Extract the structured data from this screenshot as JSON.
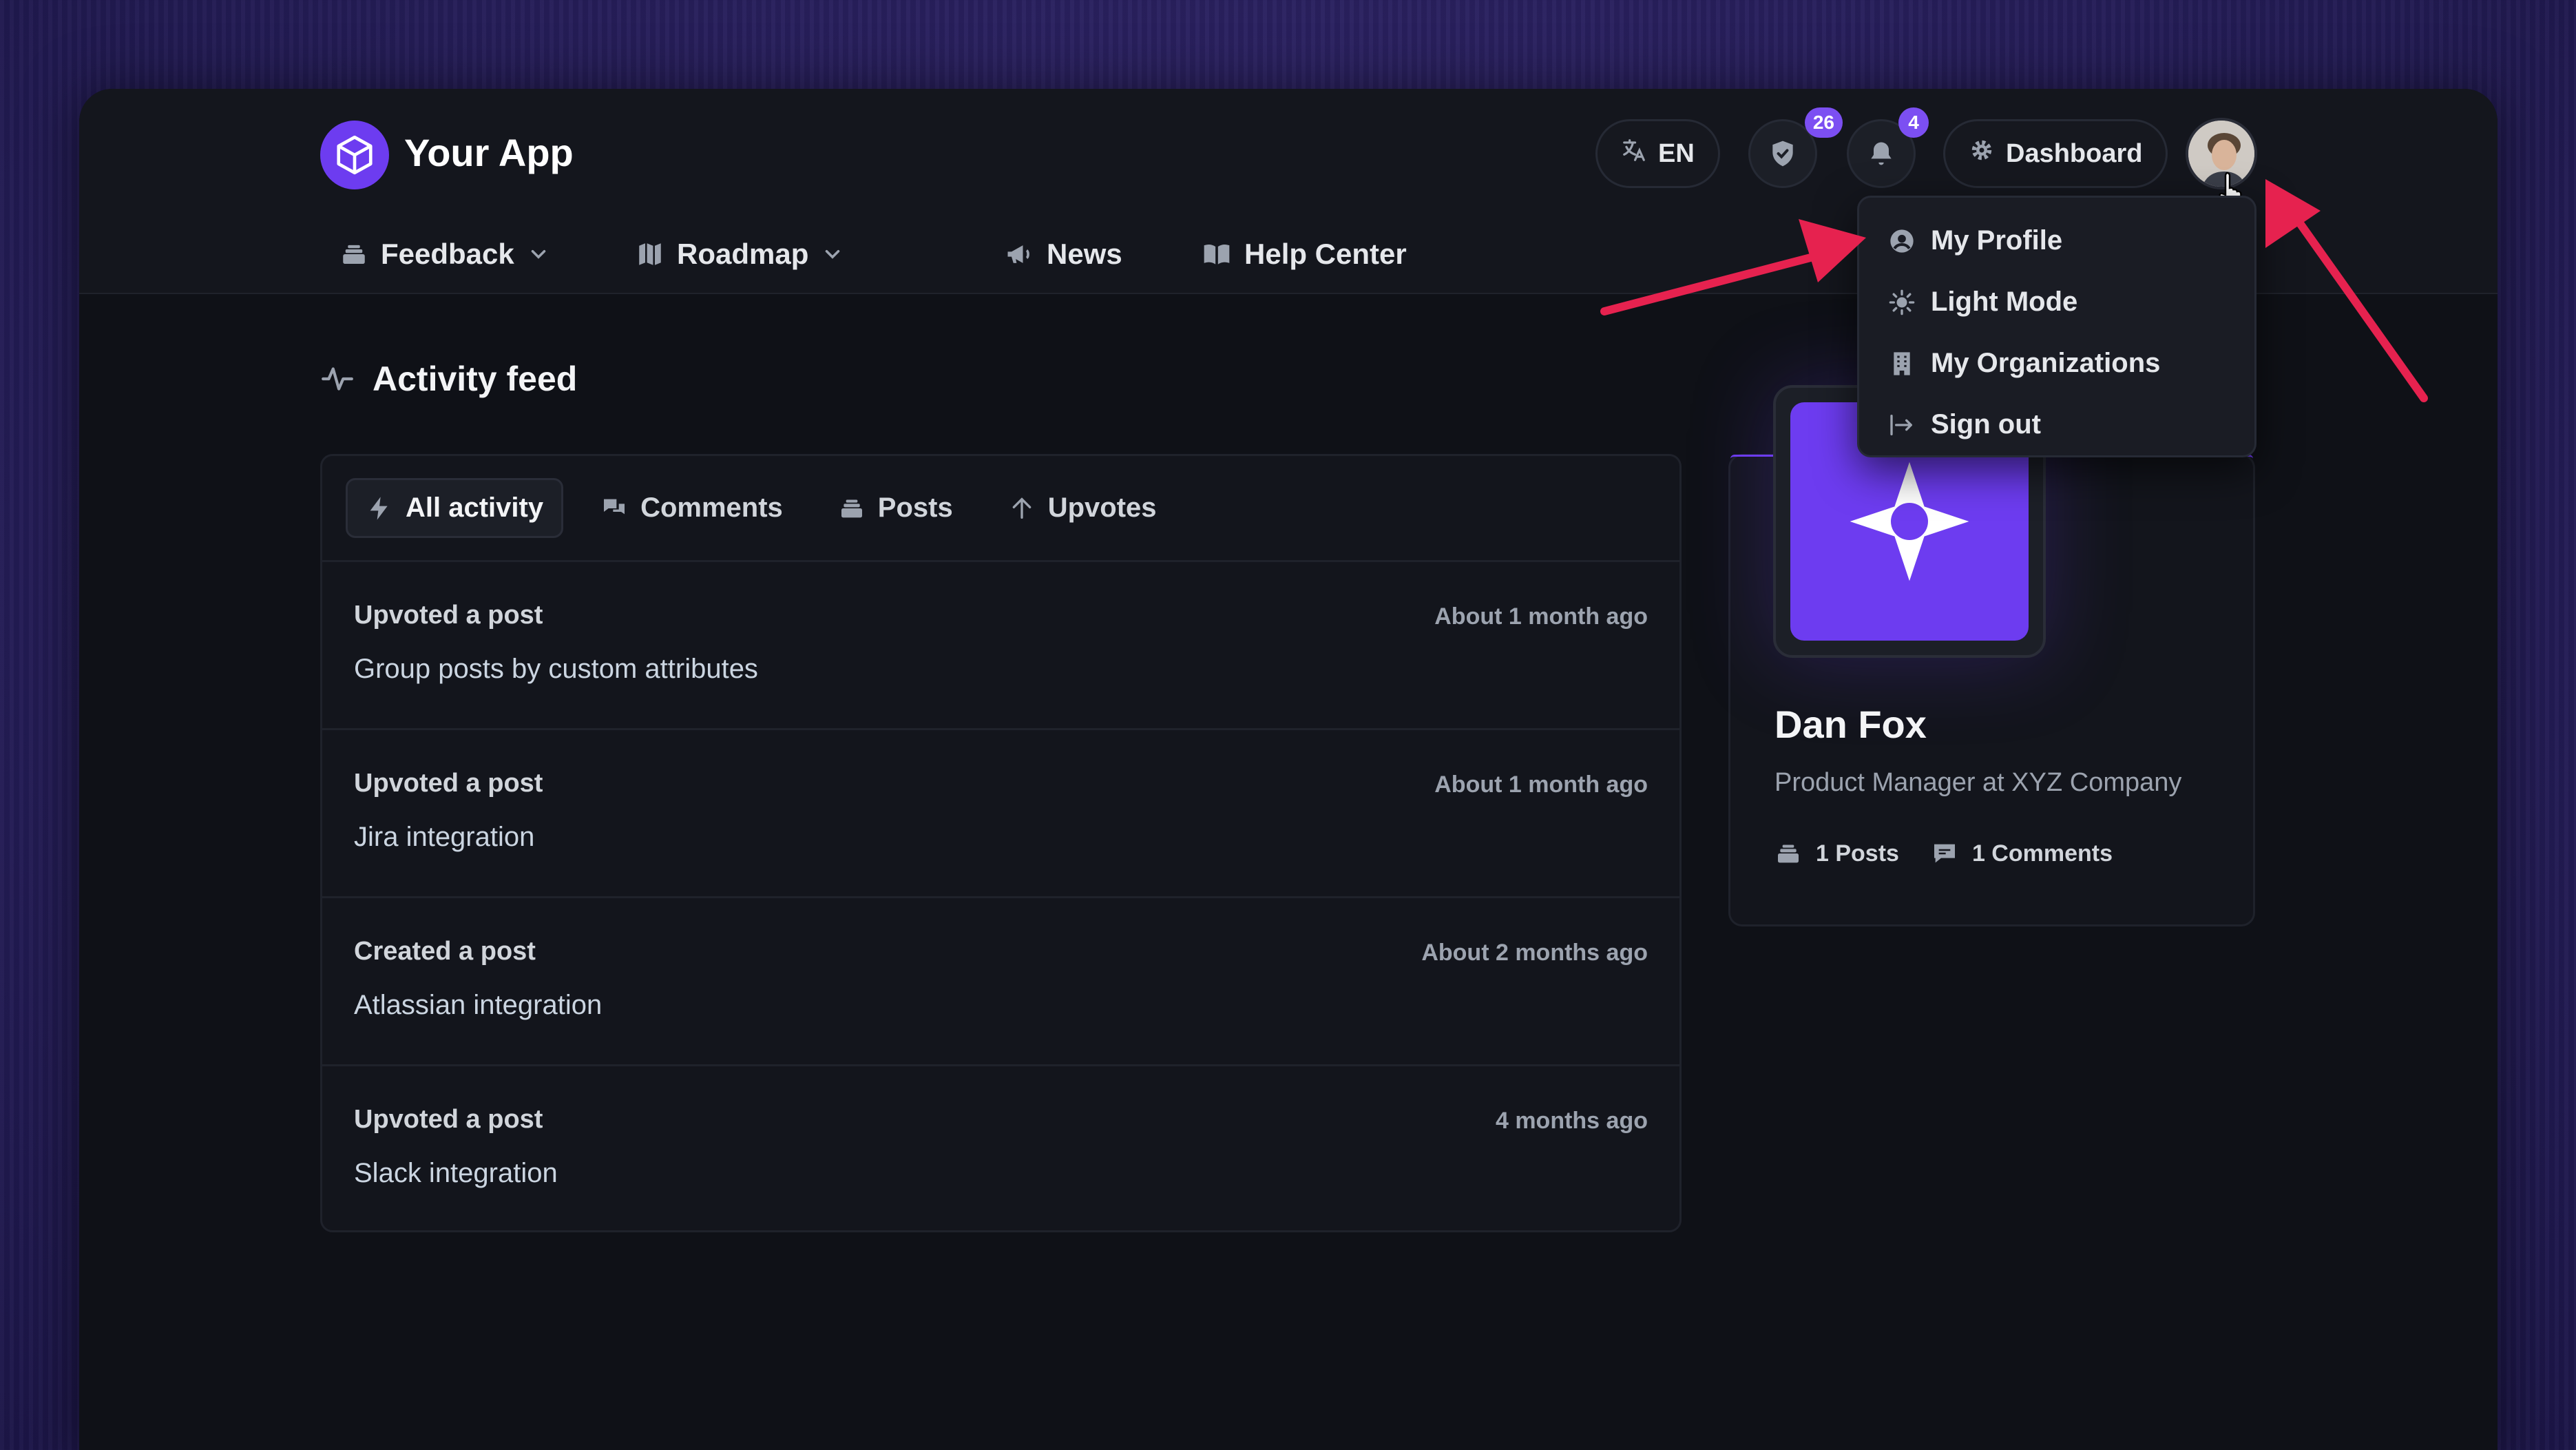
{
  "app": {
    "name": "Your App"
  },
  "header": {
    "language": "EN",
    "shield_badge": "26",
    "bell_badge": "4",
    "dashboard_label": "Dashboard"
  },
  "nav": [
    {
      "label": "Feedback",
      "icon": "inbox-stack-icon",
      "dropdown": true
    },
    {
      "label": "Roadmap",
      "icon": "map-icon",
      "dropdown": true
    },
    {
      "label": "News",
      "icon": "megaphone-icon",
      "dropdown": false
    },
    {
      "label": "Help Center",
      "icon": "book-icon",
      "dropdown": false
    }
  ],
  "activity": {
    "title": "Activity feed",
    "tabs": [
      "All activity",
      "Comments",
      "Posts",
      "Upvotes"
    ],
    "items": [
      {
        "action": "Upvoted a post",
        "subject": "Group posts by custom attributes",
        "time": "About 1 month ago"
      },
      {
        "action": "Upvoted a post",
        "subject": "Jira integration",
        "time": "About 1 month ago"
      },
      {
        "action": "Created a post",
        "subject": "Atlassian integration",
        "time": "About 2 months ago"
      },
      {
        "action": "Upvoted a post",
        "subject": "Slack integration",
        "time": "4 months ago"
      }
    ]
  },
  "profile": {
    "name": "Dan Fox",
    "role": "Product Manager at XYZ Company",
    "posts": "1 Posts",
    "comments": "1 Comments"
  },
  "user_menu": {
    "items": [
      "My Profile",
      "Light Mode",
      "My Organizations",
      "Sign out"
    ]
  },
  "colors": {
    "accent": "#6d3cf0",
    "annotation_arrow": "#e6224f",
    "background": "#0f1117"
  }
}
